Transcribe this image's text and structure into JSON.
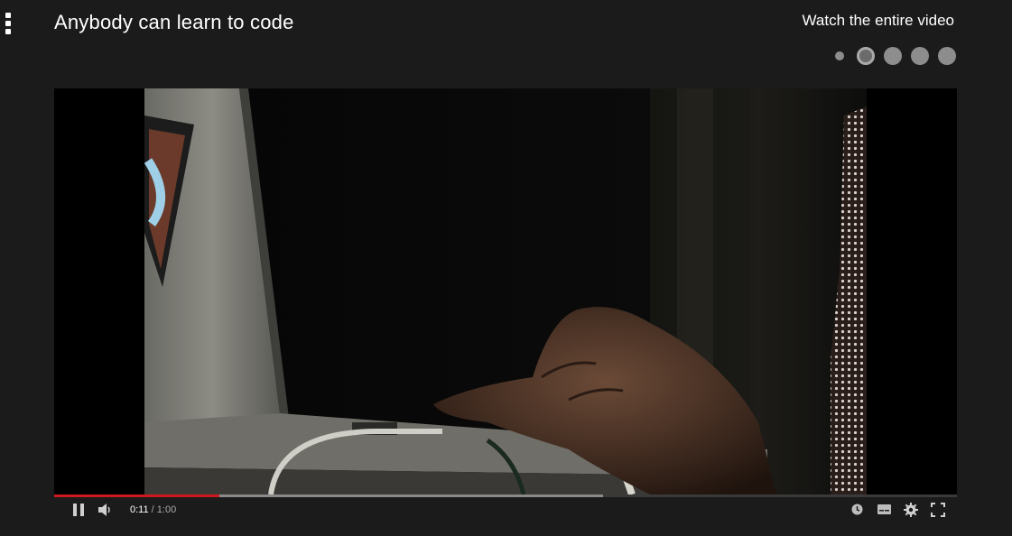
{
  "header": {
    "title": "Anybody can learn to code",
    "watch_link": "Watch the entire video"
  },
  "steps": {
    "count": 5,
    "active_index": 1
  },
  "player": {
    "current_time": "0:11",
    "separator": "/",
    "duration": "1:00",
    "played_fraction": 0.1833,
    "buffered_fraction": 0.608
  },
  "icons": {
    "menu": "more-vertical-icon",
    "pause": "pause-icon",
    "volume": "volume-icon",
    "watch_later": "clock-icon",
    "captions": "captions-icon",
    "settings": "gear-icon",
    "fullscreen": "fullscreen-icon"
  },
  "colors": {
    "progress_played": "#cc181e",
    "background": "#1b1b1b"
  }
}
